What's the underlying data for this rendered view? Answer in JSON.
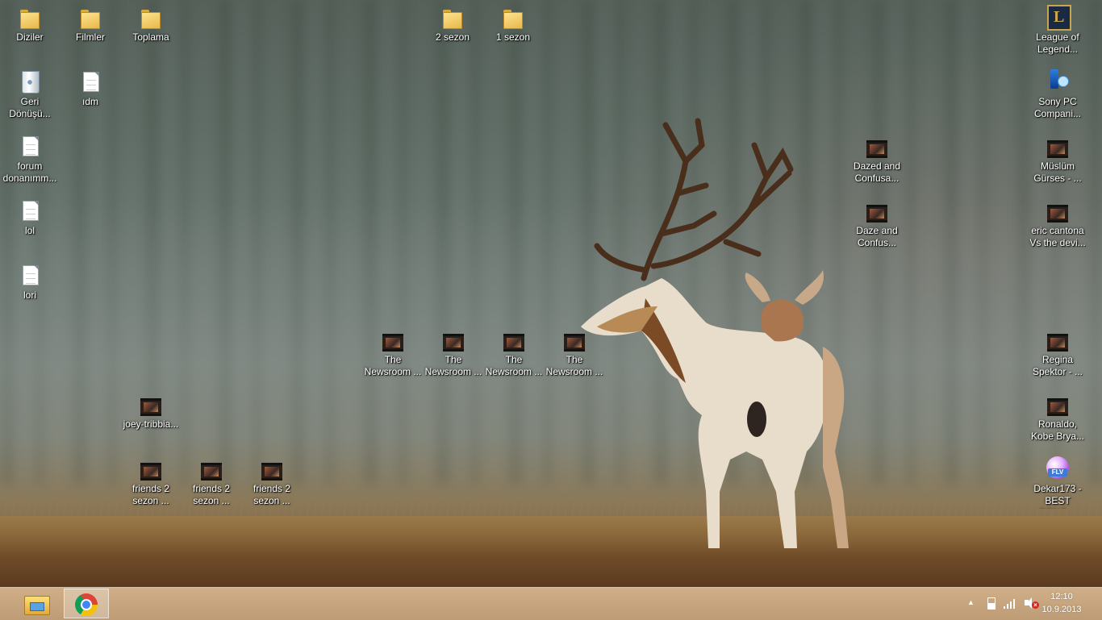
{
  "desktop": {
    "icons": [
      {
        "label": "Diziler",
        "icon": "folder-icon"
      },
      {
        "label": "Filmler",
        "icon": "folder-icon"
      },
      {
        "label": "Toplama",
        "icon": "folder-icon"
      },
      {
        "label": "2 sezon",
        "icon": "folder-icon"
      },
      {
        "label": "1 sezon",
        "icon": "folder-icon"
      },
      {
        "label": "League of Legend...",
        "icon": "league-of-legends-icon"
      },
      {
        "label": "Geri Dönüşü...",
        "icon": "recycle-bin-icon"
      },
      {
        "label": "ıdm",
        "icon": "text-document-icon"
      },
      {
        "label": "Sony PC Compani...",
        "icon": "sony-pc-companion-icon"
      },
      {
        "label": "forum donanımm...",
        "icon": "text-document-icon"
      },
      {
        "label": "Dazed and Confusa...",
        "icon": "video-file-icon"
      },
      {
        "label": "Müslüm Gürses - ...",
        "icon": "video-file-icon"
      },
      {
        "label": "lol",
        "icon": "text-document-icon"
      },
      {
        "label": "Daze and Confus...",
        "icon": "video-file-icon"
      },
      {
        "label": "eric cantona Vs the devi...",
        "icon": "video-file-icon"
      },
      {
        "label": "lori",
        "icon": "text-document-icon"
      },
      {
        "label": "The Newsroom ...",
        "icon": "video-file-icon"
      },
      {
        "label": "The Newsroom ...",
        "icon": "video-file-icon"
      },
      {
        "label": "The Newsroom ...",
        "icon": "video-file-icon"
      },
      {
        "label": "The Newsroom ...",
        "icon": "video-file-icon"
      },
      {
        "label": "Regina Spektor - ...",
        "icon": "video-file-icon"
      },
      {
        "label": "joey-tribbia...",
        "icon": "video-file-icon"
      },
      {
        "label": "Ronaldo, Kobe Brya...",
        "icon": "video-file-icon"
      },
      {
        "label": "friends 2 sezon ...",
        "icon": "video-file-icon"
      },
      {
        "label": "friends 2 sezon ...",
        "icon": "video-file-icon"
      },
      {
        "label": "friends 2 sezon ...",
        "icon": "video-file-icon"
      },
      {
        "label": "Dekar173 - BEST RENG...",
        "icon": "flv-player-icon"
      }
    ]
  },
  "taskbar": {
    "pinned": [
      {
        "name": "File Explorer",
        "icon": "file-explorer-icon"
      },
      {
        "name": "Google Chrome",
        "icon": "chrome-icon",
        "active": true
      }
    ],
    "tray": {
      "show_hidden_arrow": "▲",
      "icons": [
        "power-icon",
        "network-signal-icon",
        "volume-muted-icon"
      ]
    },
    "clock": {
      "time": "12:10",
      "date": "10.9.2013"
    }
  }
}
